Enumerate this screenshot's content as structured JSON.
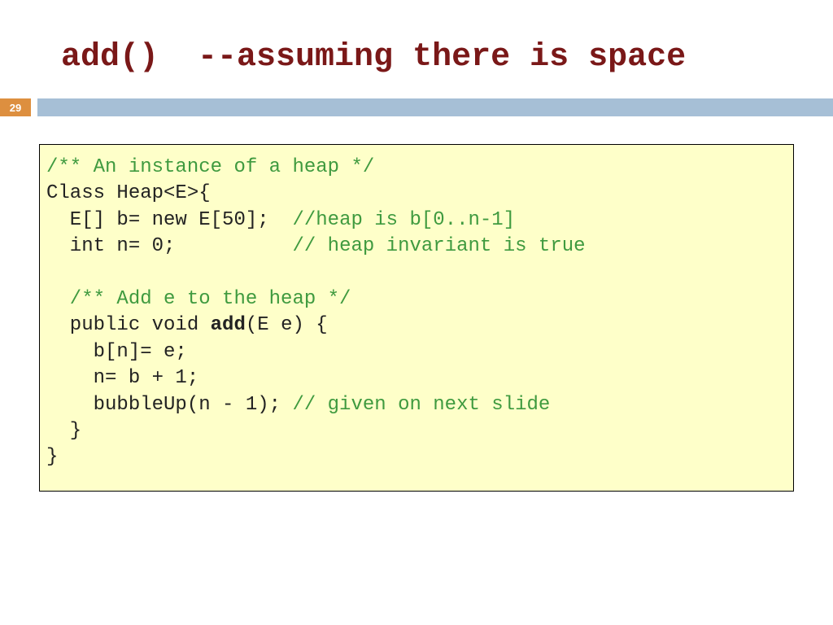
{
  "title": "add()  --assuming there is space",
  "page_number": "29",
  "code": {
    "l1": "/** An instance of a heap */",
    "l2": "Class Heap<E>{",
    "l3a": "  E[] b= new E[50];",
    "l3b": "  //heap is b[0..n-1]",
    "l4a": "  int n= 0;",
    "l4b": "          // heap invariant is true",
    "l5": "",
    "l6": "  /** Add e to the heap */",
    "l7a": "  public void ",
    "l7b": "add",
    "l7c": "(E e) {",
    "l8": "    b[n]= e;",
    "l9": "    n= b + 1;",
    "l10a": "    bubbleUp(n - 1);",
    "l10b": " // given on next slide",
    "l11": "  }",
    "l12": "}"
  }
}
